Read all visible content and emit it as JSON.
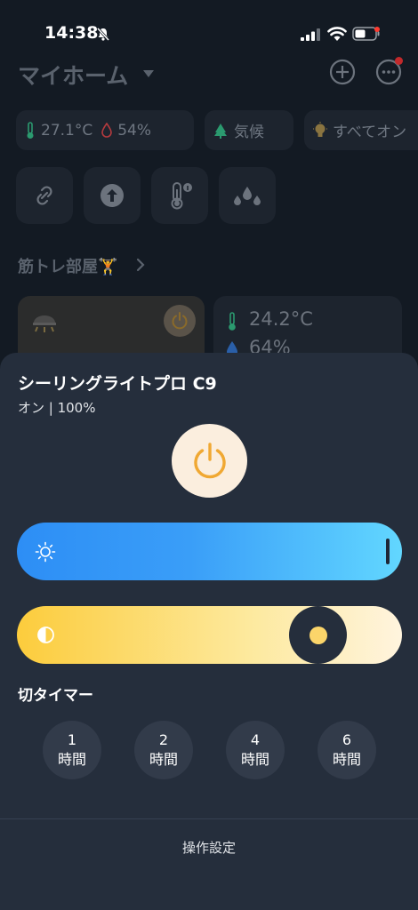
{
  "status_bar": {
    "time": "14:38"
  },
  "home": {
    "title": "マイホーム",
    "chips": {
      "temperature": "27.1°C",
      "humidity": "54%",
      "climate": "気候",
      "all_lights": "すべてオン"
    },
    "room": {
      "title": "筋トレ部屋🏋️",
      "sensor_temperature": "24.2°C",
      "sensor_humidity": "64%"
    }
  },
  "sheet": {
    "device_name": "シーリングライトプロ C9",
    "status": "オン | 100%",
    "brightness_percent": 100,
    "color_temp_fraction": 0.84,
    "timer_label": "切タイマー",
    "timers": [
      {
        "value": "1",
        "unit": "時間"
      },
      {
        "value": "2",
        "unit": "時間"
      },
      {
        "value": "4",
        "unit": "時間"
      },
      {
        "value": "6",
        "unit": "時間"
      }
    ],
    "operation_settings": "操作設定"
  },
  "colors": {
    "power_accent": "#f0a832",
    "sheet_background": "#252e3c",
    "brightness_start": "#2d8ef5",
    "brightness_end": "#62d7ff",
    "color_start": "#fccc3c",
    "color_end": "#fff4de"
  }
}
